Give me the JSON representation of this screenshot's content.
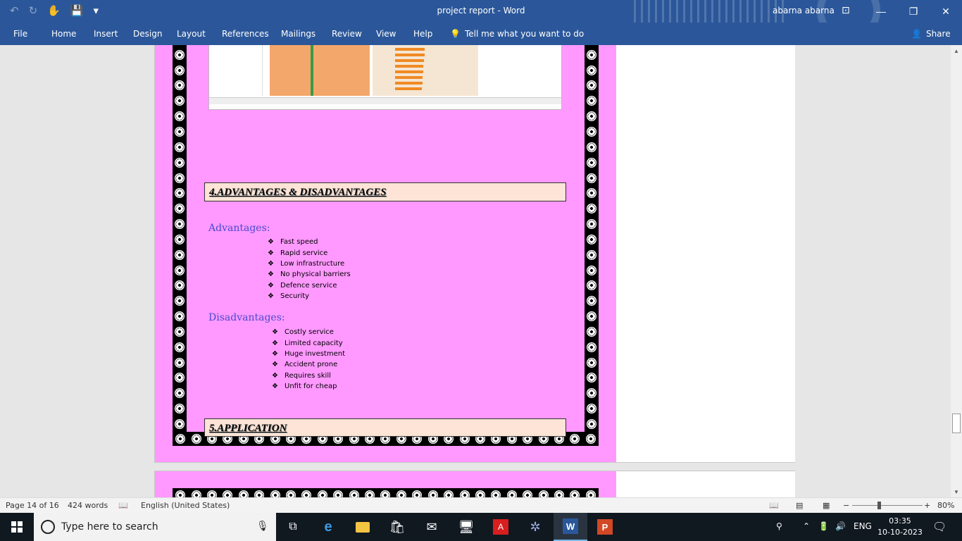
{
  "window": {
    "title": "project report  -  Word",
    "user": "abarna abarna"
  },
  "menu": {
    "items": [
      "File",
      "Home",
      "Insert",
      "Design",
      "Layout",
      "References",
      "Mailings",
      "Review",
      "View",
      "Help"
    ],
    "tell_me": "Tell me what you want to do",
    "share": "Share"
  },
  "document": {
    "section4_heading": "4.ADVANTAGES & DISADVANTAGES",
    "advantages_title": "Advantages:",
    "advantages": [
      "Fast speed",
      "Rapid service",
      "Low infrastructure",
      "No physical barriers",
      "Defence service",
      "Security"
    ],
    "disadvantages_title": "Disadvantages:",
    "disadvantages": [
      "Costly service",
      "Limited capacity",
      "Huge investment",
      "Accident prone",
      "Requires skill",
      "Unfit for cheap"
    ],
    "section5_heading": "5.APPLICATION"
  },
  "status": {
    "page": "Page 14 of 16",
    "words": "424 words",
    "language": "English (United States)",
    "zoom": "80%"
  },
  "taskbar": {
    "search_placeholder": "Type here to search",
    "lang": "ENG",
    "time": "03:35",
    "date": "10-10-2023"
  },
  "colors": {
    "word_blue": "#2b579a",
    "page_pink": "#ff99ff",
    "heading_fill": "#fde4d6",
    "subhead_blue": "#4a4ad0"
  }
}
